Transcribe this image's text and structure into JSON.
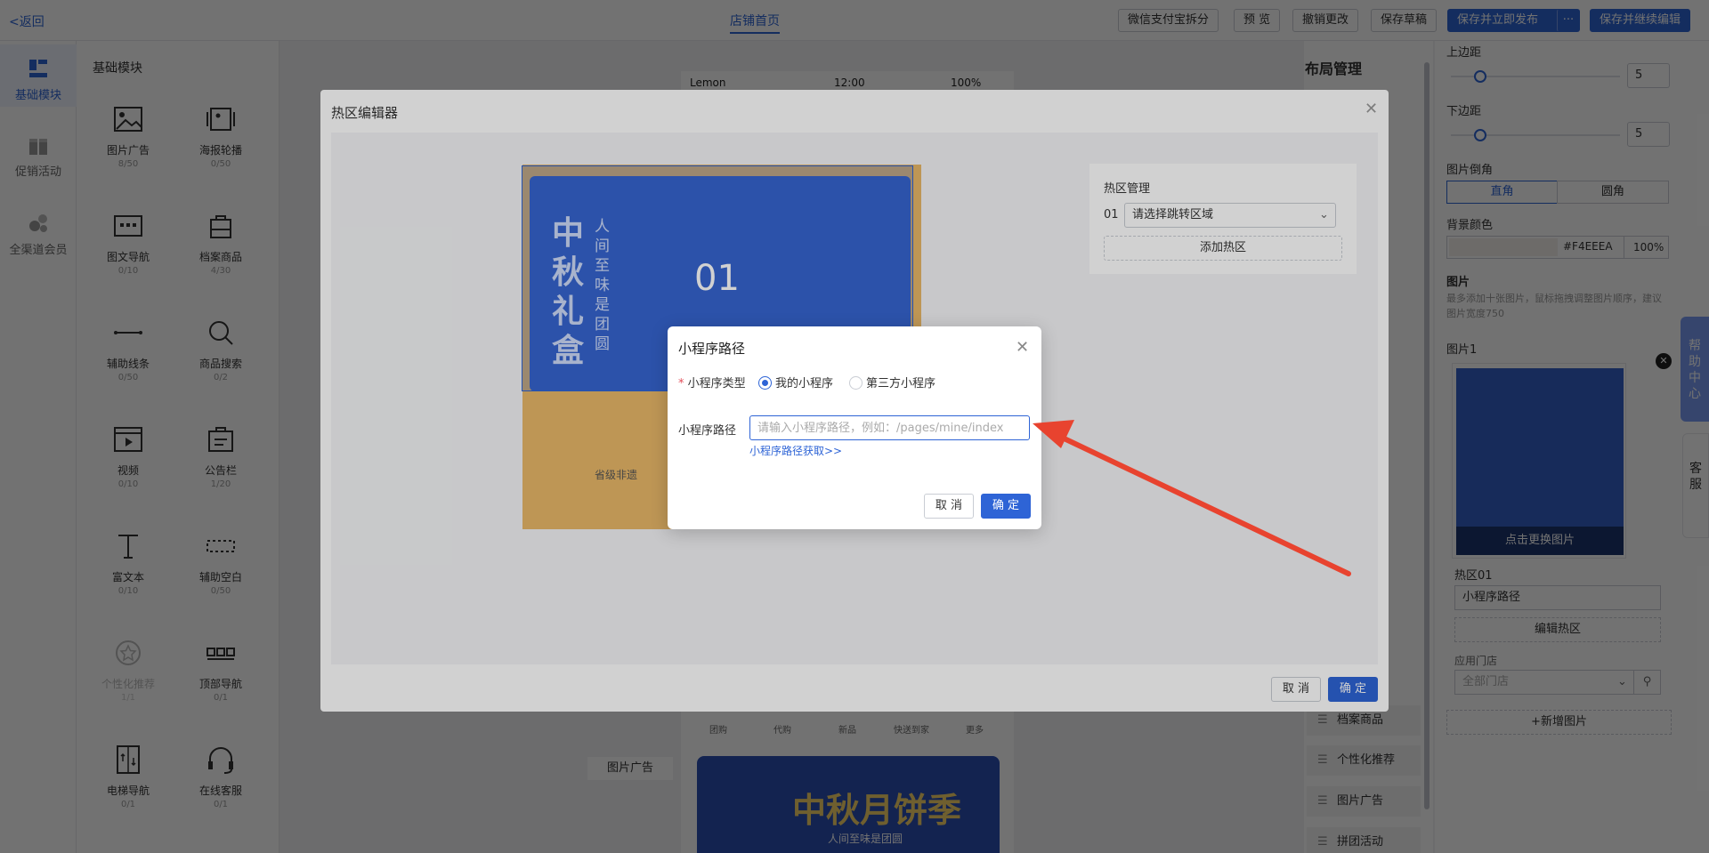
{
  "topbar": {
    "back": "<返回",
    "home_tab": "店铺首页",
    "buttons": [
      "微信支付宝拆分",
      "预 览",
      "撤销更改",
      "保存草稿"
    ],
    "publish": "保存并立即发布",
    "more": "···",
    "save_continue": "保存并继续编辑"
  },
  "rail": [
    {
      "label": "基础模块",
      "active": true
    },
    {
      "label": "促销活动",
      "active": false
    },
    {
      "label": "全渠道会员",
      "active": false
    }
  ],
  "modules": {
    "title": "基础模块",
    "items": [
      {
        "label": "图片广告",
        "count": "8/50"
      },
      {
        "label": "海报轮播",
        "count": "0/50"
      },
      {
        "label": "图文导航",
        "count": "0/10"
      },
      {
        "label": "档案商品",
        "count": "4/30"
      },
      {
        "label": "辅助线条",
        "count": "0/50"
      },
      {
        "label": "商品搜索",
        "count": "0/2"
      },
      {
        "label": "视频",
        "count": "0/10"
      },
      {
        "label": "公告栏",
        "count": "1/20"
      },
      {
        "label": "富文本",
        "count": "0/10"
      },
      {
        "label": "辅助空白",
        "count": "0/50"
      },
      {
        "label": "个性化推荐",
        "count": "1/1"
      },
      {
        "label": "顶部导航",
        "count": "0/1"
      },
      {
        "label": "电梯导航",
        "count": "0/1"
      },
      {
        "label": "在线客服",
        "count": "0/1"
      }
    ]
  },
  "phone": {
    "carrier": "Lemon",
    "time": "12:00",
    "battery": "100%",
    "nav": [
      "团购",
      "代购",
      "新品",
      "快送到家",
      "更多"
    ],
    "banner_label": "图片广告",
    "banner_title": "中秋月饼季",
    "banner_sub": "人间至味是团圆"
  },
  "layout": {
    "title": "布局管理",
    "items": [
      "档案商品",
      "个性化推荐",
      "图片广告",
      "拼团活动"
    ]
  },
  "props": {
    "top_margin_label": "上边距",
    "top_margin": "5",
    "bottom_margin_label": "下边距",
    "bottom_margin": "5",
    "corner_label": "图片倒角",
    "corner_square": "直角",
    "corner_round": "圆角",
    "bg_label": "背景颜色",
    "bg_hex": "#F4EEEA",
    "bg_opacity": "100%",
    "image_label": "图片",
    "image_hint": "最多添加十张图片，鼠标拖拽调整图片顺序，建议图片宽度750",
    "image1": "图片1",
    "replace": "点击更换图片",
    "hotspot": "热区01",
    "hotspot_value": "小程序路径",
    "edit_hotspot": "编辑热区",
    "store_label": "应用门店",
    "store_placeholder": "全部门店",
    "add_image": "+新增图片",
    "colors": {
      "bg": "#F4EEEA"
    }
  },
  "side_tabs": {
    "help": "帮助中心",
    "kefu": "客服"
  },
  "hotzone_editor": {
    "title": "热区编辑器",
    "hotspot_number": "01",
    "banner_title": "中秋礼盒",
    "banner_sub": "人间至味是团圆",
    "banner_caption": "省级非遗",
    "panel_title": "热区管理",
    "row_index": "01",
    "select_placeholder": "请选择跳转区域",
    "add_hotspot": "添加热区",
    "cancel": "取 消",
    "ok": "确 定"
  },
  "mp_dialog": {
    "title": "小程序路径",
    "type_label": "小程序类型",
    "option_mine": "我的小程序",
    "option_third": "第三方小程序",
    "path_label": "小程序路径",
    "path_placeholder": "请输入小程序路径，例如：/pages/mine/index",
    "path_link": "小程序路径获取>>",
    "cancel": "取 消",
    "ok": "确 定"
  },
  "colors": {
    "accent": "#2e64d6",
    "arrow": "#e8432f"
  }
}
